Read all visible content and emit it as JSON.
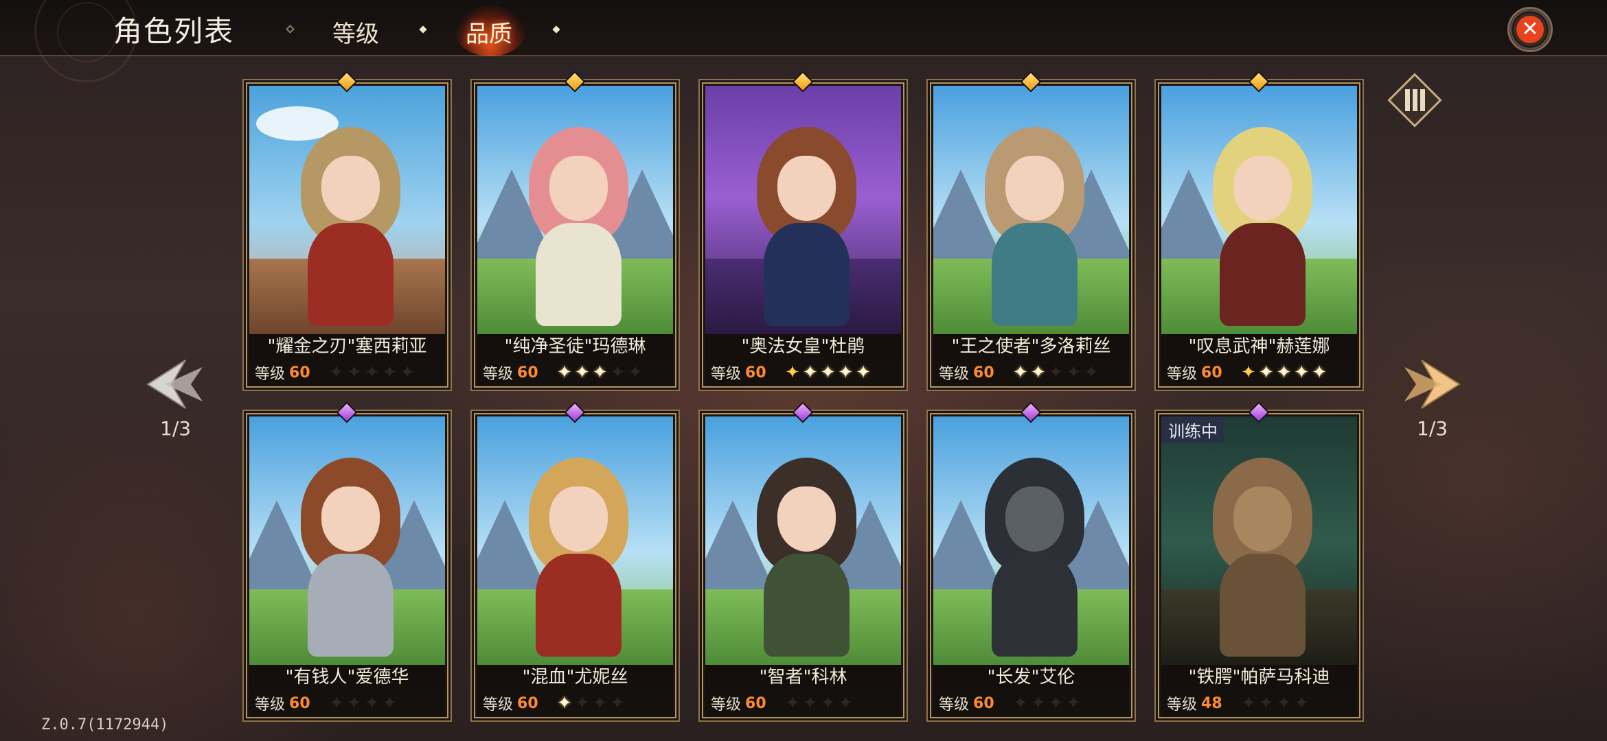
{
  "header": {
    "title": "角色列表",
    "tabs": [
      {
        "label": "等级",
        "active": false
      },
      {
        "label": "品质",
        "active": true
      }
    ],
    "close_icon": "close-icon"
  },
  "pager": {
    "left": "1/3",
    "right": "1/3"
  },
  "version": "Z.0.7(1172944)",
  "level_label": "等级",
  "colors": {
    "accent": "#ff8a2e",
    "gold_gem": "#f7b52a",
    "purple_gem": "#b566e8",
    "close": "#e8421f"
  },
  "cards": [
    {
      "name": "\"耀金之刃\"塞西莉亚",
      "level": "60",
      "stars": [
        0,
        0,
        0,
        0,
        0
      ],
      "gem": "gold",
      "badge": ""
    },
    {
      "name": "\"纯净圣徒\"玛德琳",
      "level": "60",
      "stars": [
        1,
        1,
        1,
        0,
        0
      ],
      "gem": "gold",
      "badge": ""
    },
    {
      "name": "\"奥法女皇\"杜鹃",
      "level": "60",
      "stars": [
        2,
        1,
        1,
        1,
        1
      ],
      "gem": "gold",
      "badge": ""
    },
    {
      "name": "\"王之使者\"多洛莉丝",
      "level": "60",
      "stars": [
        1,
        1,
        0,
        0,
        0
      ],
      "gem": "gold",
      "badge": ""
    },
    {
      "name": "\"叹息武神\"赫莲娜",
      "level": "60",
      "stars": [
        2,
        1,
        1,
        1,
        1
      ],
      "gem": "gold",
      "badge": ""
    },
    {
      "name": "\"有钱人\"爱德华",
      "level": "60",
      "stars": [
        0,
        0,
        0,
        0
      ],
      "gem": "purple",
      "badge": ""
    },
    {
      "name": "\"混血\"尤妮丝",
      "level": "60",
      "stars": [
        1,
        0,
        0,
        0
      ],
      "gem": "purple",
      "badge": ""
    },
    {
      "name": "\"智者\"科林",
      "level": "60",
      "stars": [
        0,
        0,
        0,
        0
      ],
      "gem": "purple",
      "badge": ""
    },
    {
      "name": "\"长发\"艾伦",
      "level": "60",
      "stars": [
        0,
        0,
        0,
        0
      ],
      "gem": "purple",
      "badge": ""
    },
    {
      "name": "\"铁腭\"帕萨马科迪",
      "level": "48",
      "stars": [
        0,
        0,
        0,
        0
      ],
      "gem": "purple",
      "badge": "训练中"
    }
  ]
}
